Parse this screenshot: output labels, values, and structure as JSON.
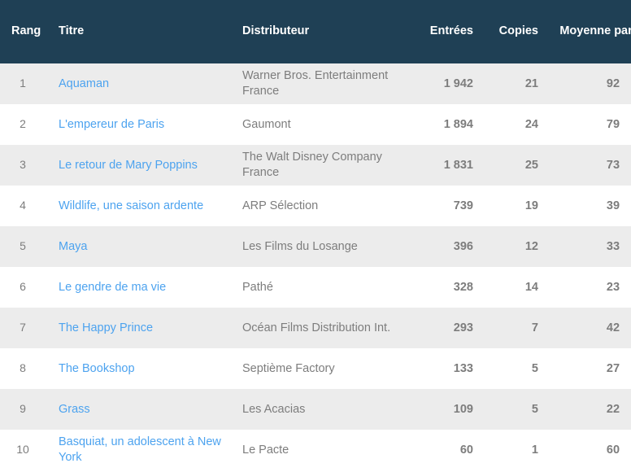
{
  "table": {
    "columns": [
      {
        "key": "rang",
        "label": "Rang"
      },
      {
        "key": "titre",
        "label": "Titre"
      },
      {
        "key": "distri",
        "label": "Distributeur"
      },
      {
        "key": "entrees",
        "label": "Entrées"
      },
      {
        "key": "copies",
        "label": "Copies"
      },
      {
        "key": "moyenne",
        "label": "Moyenne par copie"
      }
    ],
    "header_bg": "#1f4055",
    "header_fg": "#ffffff",
    "link_color": "#4da3ef",
    "text_color": "#7d7d7d",
    "alt_row_bg": "#ececec",
    "row_bg": "#ffffff",
    "rows": [
      {
        "rang": "1",
        "titre": "Aquaman",
        "distri": "Warner Bros. Entertainment France",
        "entrees": "1 942",
        "copies": "21",
        "moyenne": "92"
      },
      {
        "rang": "2",
        "titre": "L'empereur de Paris",
        "distri": "Gaumont",
        "entrees": "1 894",
        "copies": "24",
        "moyenne": "79"
      },
      {
        "rang": "3",
        "titre": "Le retour de Mary Poppins",
        "distri": "The Walt Disney Company France",
        "entrees": "1 831",
        "copies": "25",
        "moyenne": "73"
      },
      {
        "rang": "4",
        "titre": "Wildlife, une saison ardente",
        "distri": "ARP Sélection",
        "entrees": "739",
        "copies": "19",
        "moyenne": "39"
      },
      {
        "rang": "5",
        "titre": "Maya",
        "distri": "Les Films du Losange",
        "entrees": "396",
        "copies": "12",
        "moyenne": "33"
      },
      {
        "rang": "6",
        "titre": "Le gendre de ma vie",
        "distri": "Pathé",
        "entrees": "328",
        "copies": "14",
        "moyenne": "23"
      },
      {
        "rang": "7",
        "titre": "The Happy Prince",
        "distri": "Océan Films Distribution Int.",
        "entrees": "293",
        "copies": "7",
        "moyenne": "42"
      },
      {
        "rang": "8",
        "titre": "The Bookshop",
        "distri": "Septième Factory",
        "entrees": "133",
        "copies": "5",
        "moyenne": "27"
      },
      {
        "rang": "9",
        "titre": "Grass",
        "distri": "Les Acacias",
        "entrees": "109",
        "copies": "5",
        "moyenne": "22"
      },
      {
        "rang": "10",
        "titre": "Basquiat, un adolescent à New York",
        "distri": "Le Pacte",
        "entrees": "60",
        "copies": "1",
        "moyenne": "60"
      }
    ]
  }
}
